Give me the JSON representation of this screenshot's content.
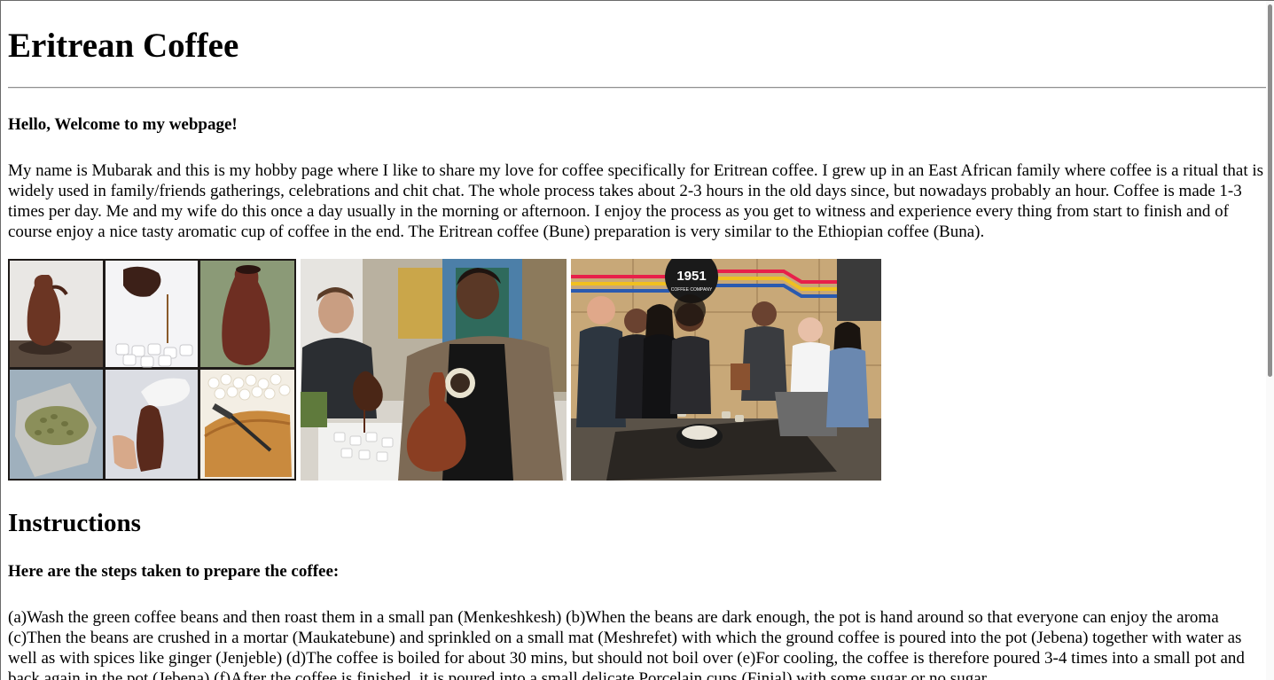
{
  "page": {
    "title": "Eritrean Coffee",
    "welcome": "Hello, Welcome to my webpage!",
    "intro": "My name is Mubarak and this is my hobby page where I like to share my love for coffee specifically for Eritrean coffee. I grew up in an East African family where coffee is a ritual that is widely used in family/friends gatherings, celebrations and chit chat. The whole process takes about 2-3 hours in the old days since, but nowadays probably an hour. Coffee is made 1-3 times per day. Me and my wife do this once a day usually in the morning or afternoon. I enjoy the process as you get to witness and experience every thing from start to finish and of course enjoy a nice tasty aromatic cup of coffee in the end. The Eritrean coffee (Bune) preparation is very similar to the Ethiopian coffee (Buna).",
    "instructions_heading": "Instructions",
    "steps_heading": "Here are the steps taken to prepare the coffee:",
    "steps_text": "(a)Wash the green coffee beans and then roast them in a small pan (Menkeshkesh) (b)When the beans are dark enough, the pot is hand around so that everyone can enjoy the aroma (c)Then the beans are crushed in a mortar (Maukatebune) and sprinkled on a small mat (Meshrefet) with which the ground coffee is poured into the pot (Jebena) together with water as well as with spices like ginger (Jenjeble) (d)The coffee is boiled for about 30 mins, but should not boil over (e)For cooling, the coffee is therefore poured 3-4 times into a small pot and back again in the pot (Jebena) (f)After the coffee is finished, it is poured into a small delicate Porcelain cups (Finjal) with some sugar or no sugar."
  },
  "photos": [
    {
      "name": "coffee-collage-photo"
    },
    {
      "name": "coffee-pouring-photo"
    },
    {
      "name": "coffee-group-photo",
      "sign_text": "1951",
      "sign_subtext": "COFFEE COMPANY"
    }
  ],
  "colors": {
    "text": "#000000",
    "background": "#ffffff",
    "rule": "#8f8f8f"
  }
}
